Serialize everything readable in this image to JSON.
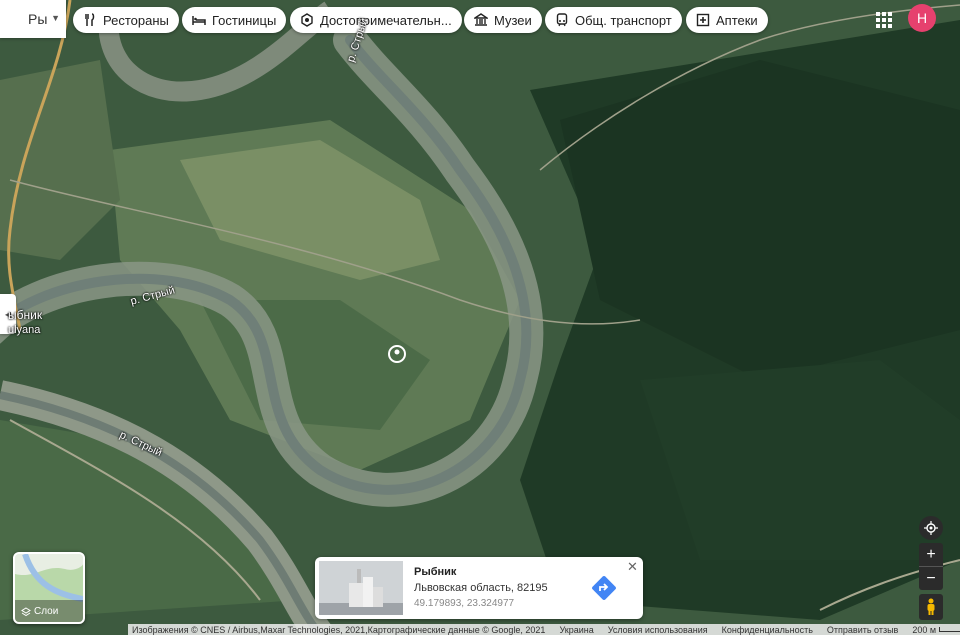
{
  "search": {
    "value": "Ры"
  },
  "categories": [
    {
      "label": "Рестораны",
      "icon": "fork-knife-icon"
    },
    {
      "label": "Гостиницы",
      "icon": "bed-icon"
    },
    {
      "label": "Достопримечательн...",
      "icon": "camera-icon"
    },
    {
      "label": "Музеи",
      "icon": "museum-icon"
    },
    {
      "label": "Общ. транспорт",
      "icon": "transit-icon"
    },
    {
      "label": "Аптеки",
      "icon": "pharmacy-icon"
    }
  ],
  "account": {
    "initial": "Н",
    "color": "#e6416e"
  },
  "map_labels": {
    "river_1": "р. Стрый",
    "river_2": "р. Стрый",
    "river_3": "р. Стрый",
    "village_1": "ыбник",
    "village_2": "ulyana"
  },
  "layers": {
    "label": "Слои"
  },
  "info_card": {
    "title": "Рыбник",
    "address": "Львовская область, 82195",
    "coordinates": "49.179893, 23.324977"
  },
  "footer": {
    "attribution": "Изображения © CNES / Airbus,Maxar Technologies, 2021,Картографические данные © Google, 2021",
    "country": "Украина",
    "terms": "Условия использования",
    "privacy": "Конфиденциальность",
    "feedback": "Отправить отзыв",
    "scale": "200 м"
  },
  "colors": {
    "accent": "#4285f4",
    "pin": "#ffffff"
  }
}
